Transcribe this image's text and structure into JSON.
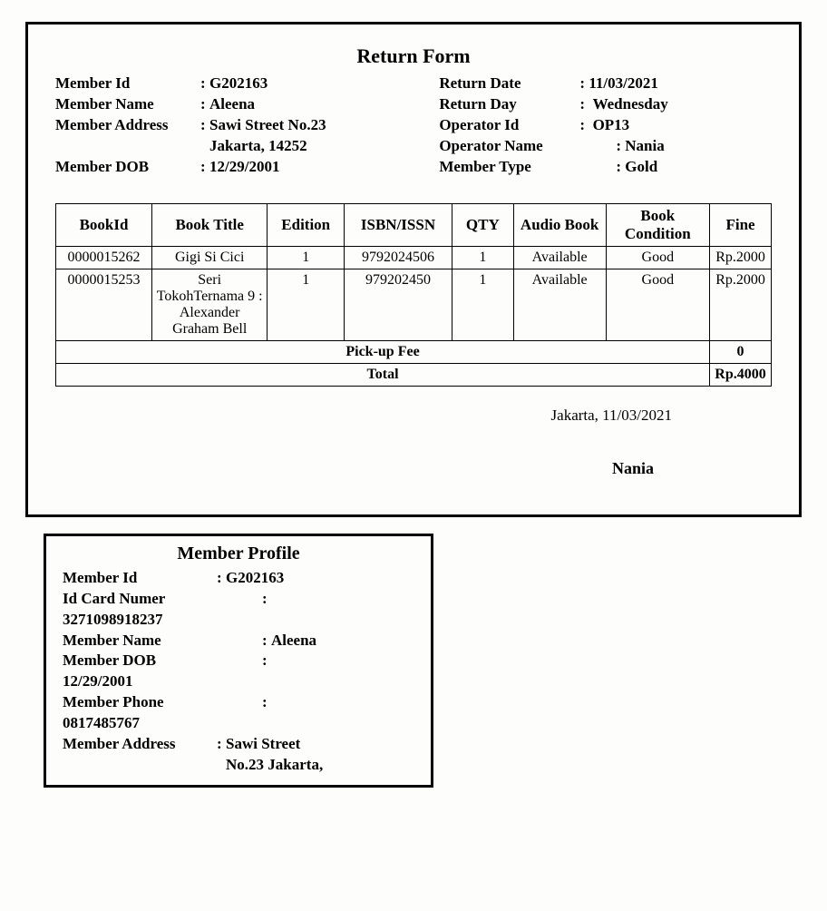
{
  "returnForm": {
    "title": "Return Form",
    "left": {
      "memberIdLabel": "Member Id",
      "memberId": "G202163",
      "memberNameLabel": "Member Name",
      "memberName": "Aleena",
      "memberAddressLabel": "Member Address",
      "memberAddress1": "Sawi Street No.23",
      "memberAddress2": "Jakarta, 14252",
      "memberDobLabel": "Member DOB",
      "memberDob": "12/29/2001"
    },
    "right": {
      "returnDateLabel": "Return Date",
      "returnDate": "11/03/2021",
      "returnDayLabel": "Return Day",
      "returnDay": "Wednesday",
      "operatorIdLabel": "Operator Id",
      "operatorId": "OP13",
      "operatorNameLabel": "Operator Name",
      "operatorName": "Nania",
      "memberTypeLabel": "Member Type",
      "memberType": "Gold"
    },
    "table": {
      "headers": {
        "bookId": "BookId",
        "bookTitle": "Book Title",
        "edition": "Edition",
        "isbn": "ISBN/ISSN",
        "qty": "QTY",
        "audio": "Audio Book",
        "condition": "Book Condition",
        "fine": "Fine"
      },
      "rows": [
        {
          "bookId": "0000015262",
          "title": "Gigi Si Cici",
          "edition": "1",
          "isbn": "9792024506",
          "qty": "1",
          "audio": "Available",
          "condition": "Good",
          "fine": "Rp.2000"
        },
        {
          "bookId": "0000015253",
          "title": "Seri TokohTernama 9 : Alexander Graham Bell",
          "edition": "1",
          "isbn": "979202450",
          "qty": "1",
          "audio": "Available",
          "condition": "Good",
          "fine": "Rp.2000"
        }
      ],
      "pickupLabel": "Pick-up Fee",
      "pickupValue": "0",
      "totalLabel": "Total",
      "totalValue": "Rp.4000"
    },
    "signature": {
      "location": "Jakarta, 11/03/2021",
      "name": "Nania"
    }
  },
  "profile": {
    "title": "Member Profile",
    "memberIdLabel": "Member Id",
    "memberId": "G202163",
    "idCardLabel": "Id  Card Numer",
    "idCard": "3271098918237",
    "memberNameLabel": "Member Name",
    "memberName": "Aleena",
    "memberDobLabel": "Member DOB",
    "memberDob": "12/29/2001",
    "memberPhoneLabel": "Member Phone",
    "memberPhone": "0817485767",
    "memberAddressLabel": "Member Address",
    "memberAddress1": "Sawi Street",
    "memberAddress2": "No.23  Jakarta,"
  }
}
